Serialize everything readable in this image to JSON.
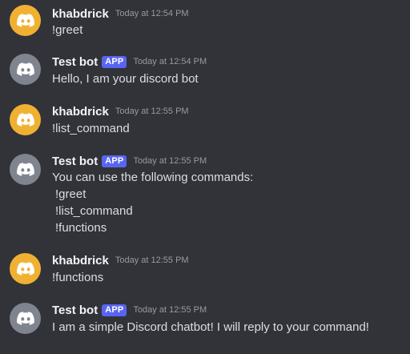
{
  "colors": {
    "background": "#313338",
    "user_avatar": "#f0b132",
    "bot_avatar": "#80848e",
    "app_badge": "#5865f2",
    "username": "#f2f3f5",
    "timestamp": "#949ba4",
    "text": "#dbdee1"
  },
  "messages": [
    {
      "author": "khabdrick",
      "bot": false,
      "avatar_icon": "discord-logo-icon",
      "timestamp": "Today at 12:54 PM",
      "lines": [
        "!greet"
      ]
    },
    {
      "author": "Test bot",
      "bot": true,
      "badge": "APP",
      "avatar_icon": "discord-logo-icon",
      "timestamp": "Today at 12:54 PM",
      "lines": [
        "Hello, I am your discord bot"
      ]
    },
    {
      "author": "khabdrick",
      "bot": false,
      "avatar_icon": "discord-logo-icon",
      "timestamp": "Today at 12:55 PM",
      "lines": [
        "!list_command"
      ]
    },
    {
      "author": "Test bot",
      "bot": true,
      "badge": "APP",
      "avatar_icon": "discord-logo-icon",
      "timestamp": "Today at 12:55 PM",
      "lines": [
        "You can use the following commands:",
        "!greet",
        "!list_command",
        "!functions"
      ]
    },
    {
      "author": "khabdrick",
      "bot": false,
      "avatar_icon": "discord-logo-icon",
      "timestamp": "Today at 12:55 PM",
      "lines": [
        "!functions"
      ]
    },
    {
      "author": "Test bot",
      "bot": true,
      "badge": "APP",
      "avatar_icon": "discord-logo-icon",
      "timestamp": "Today at 12:55 PM",
      "lines": [
        "I am a simple Discord chatbot! I will reply to your command!"
      ]
    }
  ]
}
